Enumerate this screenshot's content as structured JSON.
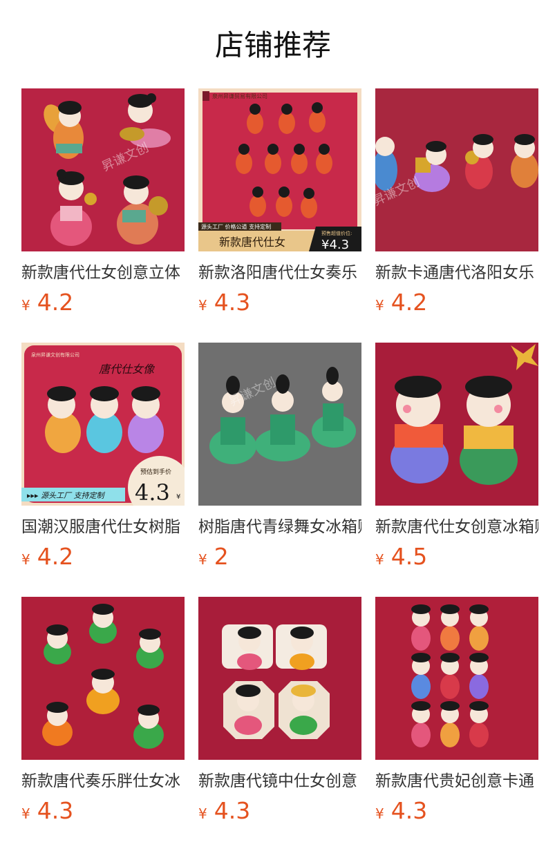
{
  "page": {
    "title": "店铺推荐"
  },
  "colors": {
    "price": "#e5521f",
    "title": "#111111",
    "name": "#333333",
    "product_background": "#b82344"
  },
  "products": [
    {
      "name": "新款唐代仕女创意立体",
      "currency": "¥",
      "price": "4.2",
      "image": "tang-lady-figurines-on-red",
      "watermark": "昇谦文创"
    },
    {
      "name": "新款洛阳唐代仕女奏乐",
      "currency": "¥",
      "price": "4.3",
      "image": "tang-lady-grid-poster",
      "poster_company": "泉州昇谦贸易有限公司",
      "poster_tag": "源头工厂 价格公道 支持定制",
      "poster_title": "新款唐代仕女",
      "poster_price_label": "预售超值价位:",
      "poster_price": "¥4.3"
    },
    {
      "name": "新款卡通唐代洛阳女乐",
      "currency": "¥",
      "price": "4.2",
      "image": "tang-musicians-in-row",
      "watermark": "昇谦文创"
    },
    {
      "name": "国潮汉服唐代仕女树脂",
      "currency": "¥",
      "price": "4.2",
      "image": "tang-lady-portrait-poster",
      "poster_company": "泉州昇谦文创有限公司",
      "poster_title": "唐代仕女像",
      "poster_tag": "▸▸▸ 源头工厂 支持定制",
      "poster_price_label": "预估到手价",
      "poster_price": "4.3",
      "poster_currency": "¥"
    },
    {
      "name": "树脂唐代青绿舞女冰箱贴",
      "currency": "¥",
      "price": "2",
      "image": "green-dancers-on-gray",
      "watermark": "昇谦文创"
    },
    {
      "name": "新款唐代仕女创意冰箱贴",
      "currency": "¥",
      "price": "4.5",
      "image": "chubby-tang-ladies-with-ribbon"
    },
    {
      "name": "新款唐代奏乐胖仕女冰",
      "currency": "¥",
      "price": "4.3",
      "image": "chubby-musicians-cluster"
    },
    {
      "name": "新款唐代镜中仕女创意",
      "currency": "¥",
      "price": "4.3",
      "image": "mirror-frame-ladies"
    },
    {
      "name": "新款唐代贵妃创意卡通",
      "currency": "¥",
      "price": "4.3",
      "image": "consort-figurines-grid"
    }
  ]
}
